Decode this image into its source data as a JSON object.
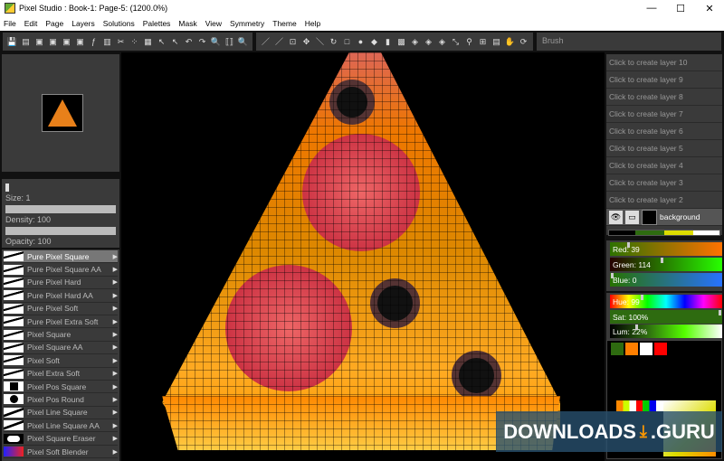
{
  "title": "Pixel Studio : Book-1: Page-5:  (1200.0%)",
  "window_controls": [
    "—",
    "☐",
    "✕"
  ],
  "menu": [
    "File",
    "Edit",
    "Page",
    "Layers",
    "Solutions",
    "Palettes",
    "Mask",
    "View",
    "Symmetry",
    "Theme",
    "Help"
  ],
  "toolbar": {
    "file_tools": [
      "💾",
      "▤",
      "▣",
      "▣",
      "▣",
      "▣",
      "ƒ",
      "▥",
      "✂",
      "⁘",
      "▦",
      "↖",
      "↖",
      "↶",
      "↷",
      "🔍",
      "⟦⟧",
      "🔍"
    ],
    "draw_tools": [
      "／",
      "／",
      "⊡",
      "✥",
      "＼",
      "↻",
      "□",
      "●",
      "◆",
      "▮",
      "▩",
      "◈",
      "◈",
      "◈",
      "⤡",
      "⚲",
      "⊞",
      "▤",
      "✋",
      "⟳"
    ],
    "brush_field": "Brush"
  },
  "brush_settings": {
    "size": "Size: 1",
    "density": "Density: 100",
    "opacity": "Opacity: 100"
  },
  "brushes": [
    "Pure Pixel Square",
    "Pure Pixel Square AA",
    "Pure Pixel Hard",
    "Pure Pixel Hard AA",
    "Pure Pixel Soft",
    "Pure Pixel Extra Soft",
    "Pixel Square",
    "Pixel Square AA",
    "Pixel Soft",
    "Pixel Extra Soft",
    "Pixel Pos Square",
    "Pixel Pos Round",
    "Pixel Line Square",
    "Pixel Line Square AA",
    "Pixel Square Eraser",
    "Pixel Soft Blender"
  ],
  "layers": [
    "Click to create layer 10",
    "Click to create layer 9",
    "Click to create layer 8",
    "Click to create layer 7",
    "Click to create layer 6",
    "Click to create layer 5",
    "Click to create layer 4",
    "Click to create layer 3",
    "Click to create layer 2"
  ],
  "active_layer": "background",
  "color": {
    "red": "Red: 39",
    "green": "Green: 114",
    "blue": "Blue: 0",
    "hue": "Hue: 99",
    "sat": "Sat: 100%",
    "lum": "Lum: 22%",
    "red_val": 39,
    "green_val": 114,
    "blue_val": 0,
    "hue_val": 99,
    "sat_val": 100,
    "lum_val": 22
  },
  "palette": [
    "#2e6b10",
    "#ff7f00",
    "#ffffff",
    "#ff0000"
  ],
  "watermark": {
    "left": "DOWNLOADS",
    "icon": "⤓",
    "right": ".GURU"
  }
}
